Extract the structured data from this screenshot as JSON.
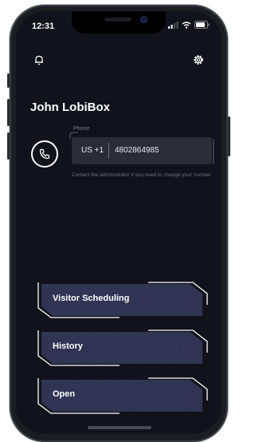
{
  "status": {
    "time": "12:31"
  },
  "header": {
    "bell_icon": "bell-icon",
    "settings_icon": "gear-icon"
  },
  "user": {
    "name": "John LobiBox"
  },
  "phone": {
    "label": "Phone",
    "country_code": "US +1",
    "number": "4802864985",
    "helper": "Contact the administrator if you need to change your number"
  },
  "actions": {
    "visitor_scheduling": "Visitor Scheduling",
    "history": "History",
    "open": "Open"
  },
  "colors": {
    "background": "#11121b",
    "accent": "#ffffff",
    "field": "#2a2c37"
  }
}
